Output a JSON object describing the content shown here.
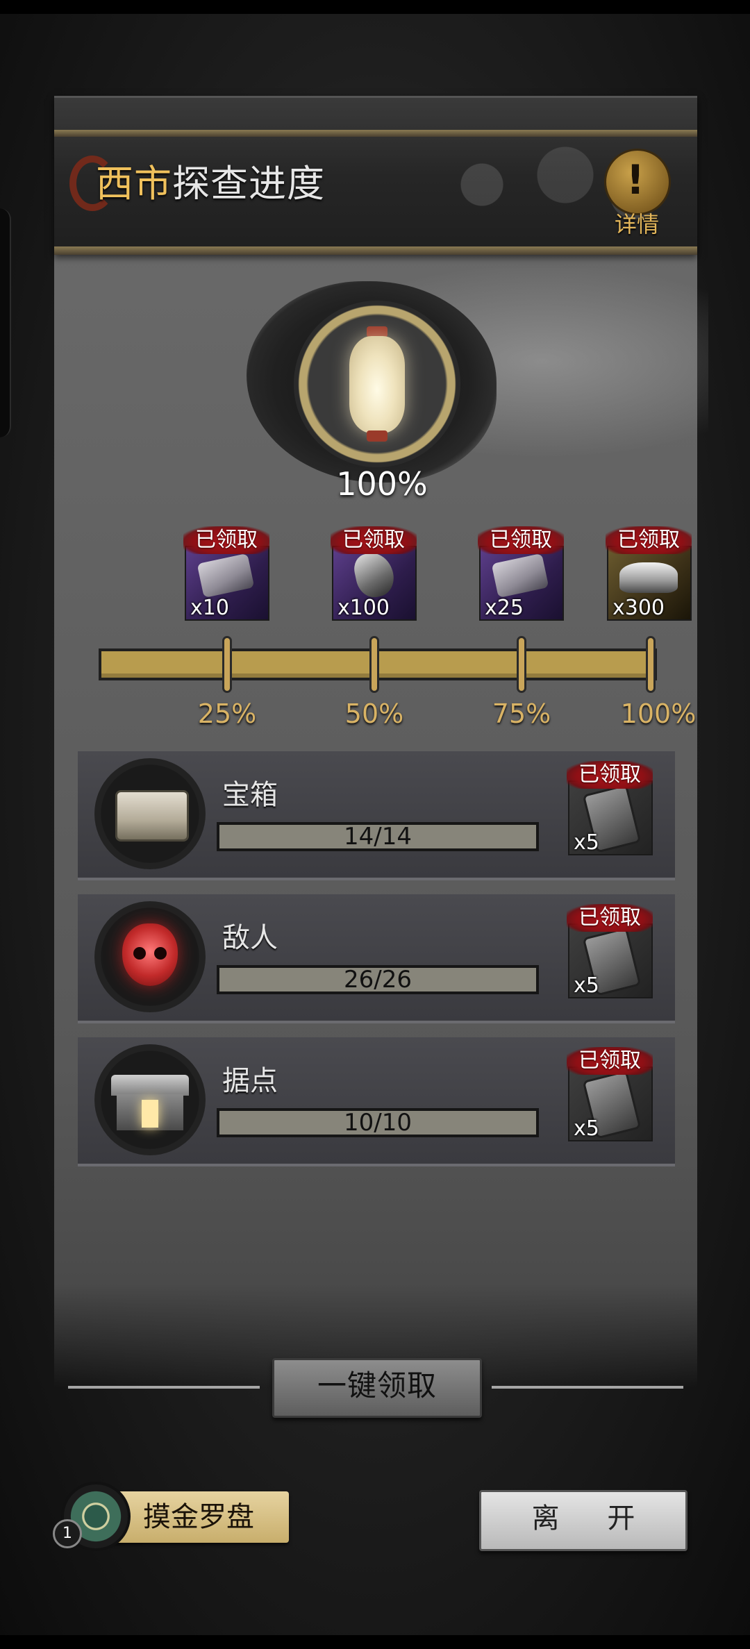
{
  "header": {
    "title_highlight": "西市",
    "title_rest": "探查进度",
    "detail_icon": "!",
    "detail_label": "详情"
  },
  "progress": {
    "overall_label": "100%",
    "overall_value": 1.0,
    "milestones": [
      {
        "percent": "25%",
        "qty": "x10",
        "item": "silver-bar-icon",
        "status": "已领取"
      },
      {
        "percent": "50%",
        "qty": "x100",
        "item": "ore-stone-icon",
        "status": "已领取"
      },
      {
        "percent": "75%",
        "qty": "x25",
        "item": "silver-bar-icon",
        "status": "已领取"
      },
      {
        "percent": "100%",
        "qty": "x300",
        "item": "silver-ingot-icon",
        "status": "已领取"
      }
    ]
  },
  "tasks": [
    {
      "label": "宝箱",
      "progress": "14/14",
      "icon": "treasure-chest-icon",
      "reward_qty": "x5",
      "reward_status": "已领取"
    },
    {
      "label": "敌人",
      "progress": "26/26",
      "icon": "enemy-skull-icon",
      "reward_qty": "x5",
      "reward_status": "已领取"
    },
    {
      "label": "据点",
      "progress": "10/10",
      "icon": "stronghold-icon",
      "reward_qty": "x5",
      "reward_status": "已领取"
    }
  ],
  "buttons": {
    "claim_all": "一键领取",
    "compass": "摸金罗盘",
    "compass_count": "1",
    "leave": "离 开"
  },
  "colors": {
    "accent_gold": "#f0c15c",
    "progress_gold": "#b89c4e",
    "claimed_red": "#a8141a"
  }
}
